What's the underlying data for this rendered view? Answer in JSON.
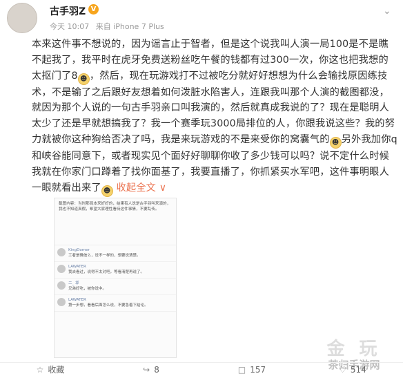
{
  "post": {
    "username": "古手羽Z",
    "verified_badge": "V",
    "time": "今天 10:07",
    "source": "来自 iPhone 7 Plus",
    "body_1": "本来这件事不想说的，因为谣言止于智者，但是这个说我叫人演一局100是不是瞧不起我了，我平时在虎牙免费送粉丝吃午餐的钱都有过300一次，你这也把我想的太抠门了8",
    "body_2": "，然后，现在玩游戏打不过被吃分就好好想想为什么会输找原因练技术，不是输了之后跟好友想着如何泼脏水陷害人，连跟我叫那个人演的截图都没，就因为那个人说的一句古手羽亲口叫我演的，然后就真成我说的了？现在是聪明人太少了还是早就想搞我了？我一个赛季玩3000局排位的人，你跟我说这些？我的努力就被你这种狗给否决了吗，我是来玩游戏的不是来受你的窝囊气的",
    "body_3": "另外我加你q和峡谷能同意下，或者现实见个面好好聊聊你收了多少钱可以吗？说不定什么时候我就在你家门口蹲着了找你面基了，我要直播了，你抓紧买水军吧，这件事明眼人一眼就看出来了",
    "expand_label": "收起全文",
    "expand_arrow": "∨"
  },
  "screenshot": {
    "top_text": "截图内容：当时那局本来好好的，结果有人说是古手羽叫来演的，我也不知道真假，希望大家理性看待这件事情，不要乱传。",
    "comments": [
      {
        "name": "KingDomer",
        "text": "工者是确信么，说不一样的，想要说清楚。"
      },
      {
        "name": "LAWATER",
        "text": "我去看过，说得不太对吧，等看清楚再说了。"
      },
      {
        "name": "二_ 邶",
        "text": "兄弟好吃，被你说中。"
      },
      {
        "name": "LAWATER",
        "text": "第一步想，看看后面怎么说，不要急着下结论。"
      }
    ]
  },
  "actions": {
    "collect": "收藏",
    "forward": "8",
    "comment": "157",
    "like": "514"
  },
  "watermark": {
    "top": "金 玩",
    "bottom": "茶归手游网"
  },
  "icons": {
    "chevron": "chevron-down-icon",
    "collect": "star-icon",
    "forward": "forward-icon",
    "comment": "comment-icon",
    "like": "like-icon"
  }
}
